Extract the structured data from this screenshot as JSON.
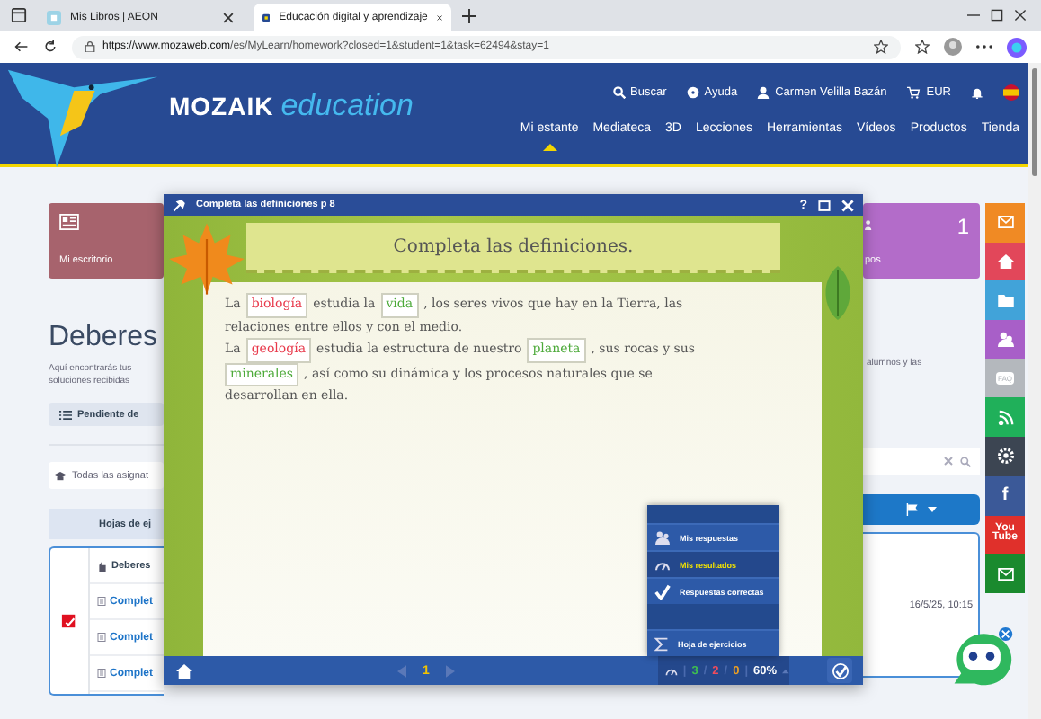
{
  "browser": {
    "tabs": [
      {
        "title": "Mis Libros | AEON",
        "selected": false
      },
      {
        "title": "Educación digital y aprendizaje",
        "selected": true
      }
    ],
    "url_host": "https://www.mozaweb.com",
    "url_path": "/es/MyLearn/homework?closed=1&student=1&task=62494&stay=1"
  },
  "header": {
    "brand": "MOZAIK",
    "brand_sub": "education",
    "top_links": [
      {
        "kind": "search",
        "label": "Buscar"
      },
      {
        "kind": "help",
        "label": "Ayuda"
      },
      {
        "kind": "user",
        "label": "Carmen Velilla Bazán"
      },
      {
        "kind": "cart",
        "label": "EUR"
      }
    ],
    "nav": [
      {
        "label": "Mi estante",
        "selected": true
      },
      {
        "label": "Mediateca",
        "selected": false
      },
      {
        "label": "3D",
        "selected": false
      },
      {
        "label": "Lecciones",
        "selected": false
      },
      {
        "label": "Herramientas",
        "selected": false
      },
      {
        "label": "Vídeos",
        "selected": false
      },
      {
        "label": "Productos",
        "selected": false
      },
      {
        "label": "Tienda",
        "selected": false
      }
    ]
  },
  "page": {
    "desk_card": "Mi escritorio",
    "groups_card": {
      "count": "1",
      "label": "pos"
    },
    "title": "Deberes",
    "description_left": [
      "Aquí encontrarás tus",
      "soluciones recibidas"
    ],
    "description_right": "alumnos y las",
    "pending_button": "Pendiente de",
    "subject_filter": "Todas las asignat",
    "table_header": "Hojas de ej",
    "rows": [
      {
        "kind": "group",
        "label": "Deberes"
      },
      {
        "kind": "sheet",
        "label": "Complet"
      },
      {
        "kind": "sheet",
        "label": "Complet"
      },
      {
        "kind": "sheet",
        "label": "Complet"
      }
    ],
    "date": "16/5/25, 10:15"
  },
  "social": [
    {
      "kind": "mail",
      "color": "#f08a24"
    },
    {
      "kind": "house",
      "color": "#e2475a"
    },
    {
      "kind": "folder",
      "color": "#41a3d9"
    },
    {
      "kind": "people",
      "color": "#a85fc8"
    },
    {
      "kind": "faq",
      "color": "#b4b8bd",
      "label": "FAQ"
    },
    {
      "kind": "rss",
      "color": "#20b05a"
    },
    {
      "kind": "gear",
      "color": "#3c4552"
    },
    {
      "kind": "text",
      "color": "#3b5998",
      "label": "f"
    },
    {
      "kind": "text",
      "color": "#e0302b",
      "label": "You Tube"
    },
    {
      "kind": "mail",
      "color": "#1a8a2e"
    }
  ],
  "exercise": {
    "window_title": "Completa las definiciones p 8",
    "help": "?",
    "heading": "Completa las definiciones.",
    "lines": [
      [
        {
          "kind": "text",
          "text": "La"
        },
        {
          "kind": "answer",
          "text": "biología",
          "correct": false
        },
        {
          "kind": "text",
          "text": "estudia la"
        },
        {
          "kind": "answer",
          "text": "vida",
          "correct": true
        },
        {
          "kind": "text",
          "text": ", los seres vivos que hay en la Tierra, las"
        }
      ],
      [
        {
          "kind": "text",
          "text": "relaciones entre ellos y con el medio."
        }
      ],
      [
        {
          "kind": "text",
          "text": "La"
        },
        {
          "kind": "answer",
          "text": "geología",
          "correct": false
        },
        {
          "kind": "text",
          "text": "estudia la estructura de nuestro"
        },
        {
          "kind": "answer",
          "text": "planeta",
          "correct": true
        },
        {
          "kind": "text",
          "text": ", sus rocas y sus"
        }
      ],
      [
        {
          "kind": "answer",
          "text": "minerales",
          "correct": true
        },
        {
          "kind": "text",
          "text": ", así como su dinámica y los procesos naturales que se"
        }
      ],
      [
        {
          "kind": "text",
          "text": "desarrollan en ella."
        }
      ]
    ],
    "menu": [
      {
        "kind": "answers",
        "label": "Mis respuestas",
        "selected": false
      },
      {
        "kind": "results",
        "label": "Mis resultados",
        "selected": true
      },
      {
        "kind": "check",
        "label": "Respuestas correctas",
        "selected": false
      },
      {
        "kind": "gap"
      },
      {
        "kind": "sum",
        "label": "Hoja de ejercicios",
        "selected": false
      }
    ],
    "page": "1",
    "score": {
      "correct": "3",
      "wrong": "2",
      "empty": "0",
      "percent": "60%",
      "separators": [
        "|",
        "/",
        "/",
        "|"
      ]
    }
  }
}
